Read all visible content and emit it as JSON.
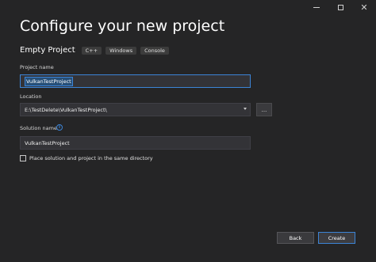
{
  "window": {
    "minimize_label": "minimize",
    "maximize_label": "maximize",
    "close_glyph": "✕"
  },
  "header": {
    "title": "Configure your new project"
  },
  "template": {
    "name": "Empty Project",
    "tags": [
      "C++",
      "Windows",
      "Console"
    ]
  },
  "form": {
    "project_name_label": "Project name",
    "project_name_value": "VulkanTestProject",
    "location_label": "Location",
    "location_value": "E:\\TestDelete\\VulkanTestProject\\",
    "browse_label": "...",
    "solution_name_label": "Solution name",
    "solution_name_value": "VulkanTestProject",
    "info_glyph": "i",
    "same_directory_label": "Place solution and project in the same directory",
    "same_directory_checked": false
  },
  "footer": {
    "back_label": "Back",
    "create_label": "Create"
  },
  "colors": {
    "background": "#252526",
    "field_background": "#333337",
    "accent": "#3c84d6",
    "selection": "#264f78"
  },
  "icons": {
    "minimize": "minimize-icon",
    "maximize": "maximize-icon",
    "close": "close-icon",
    "dropdown": "chevron-down-icon",
    "info": "info-icon"
  }
}
